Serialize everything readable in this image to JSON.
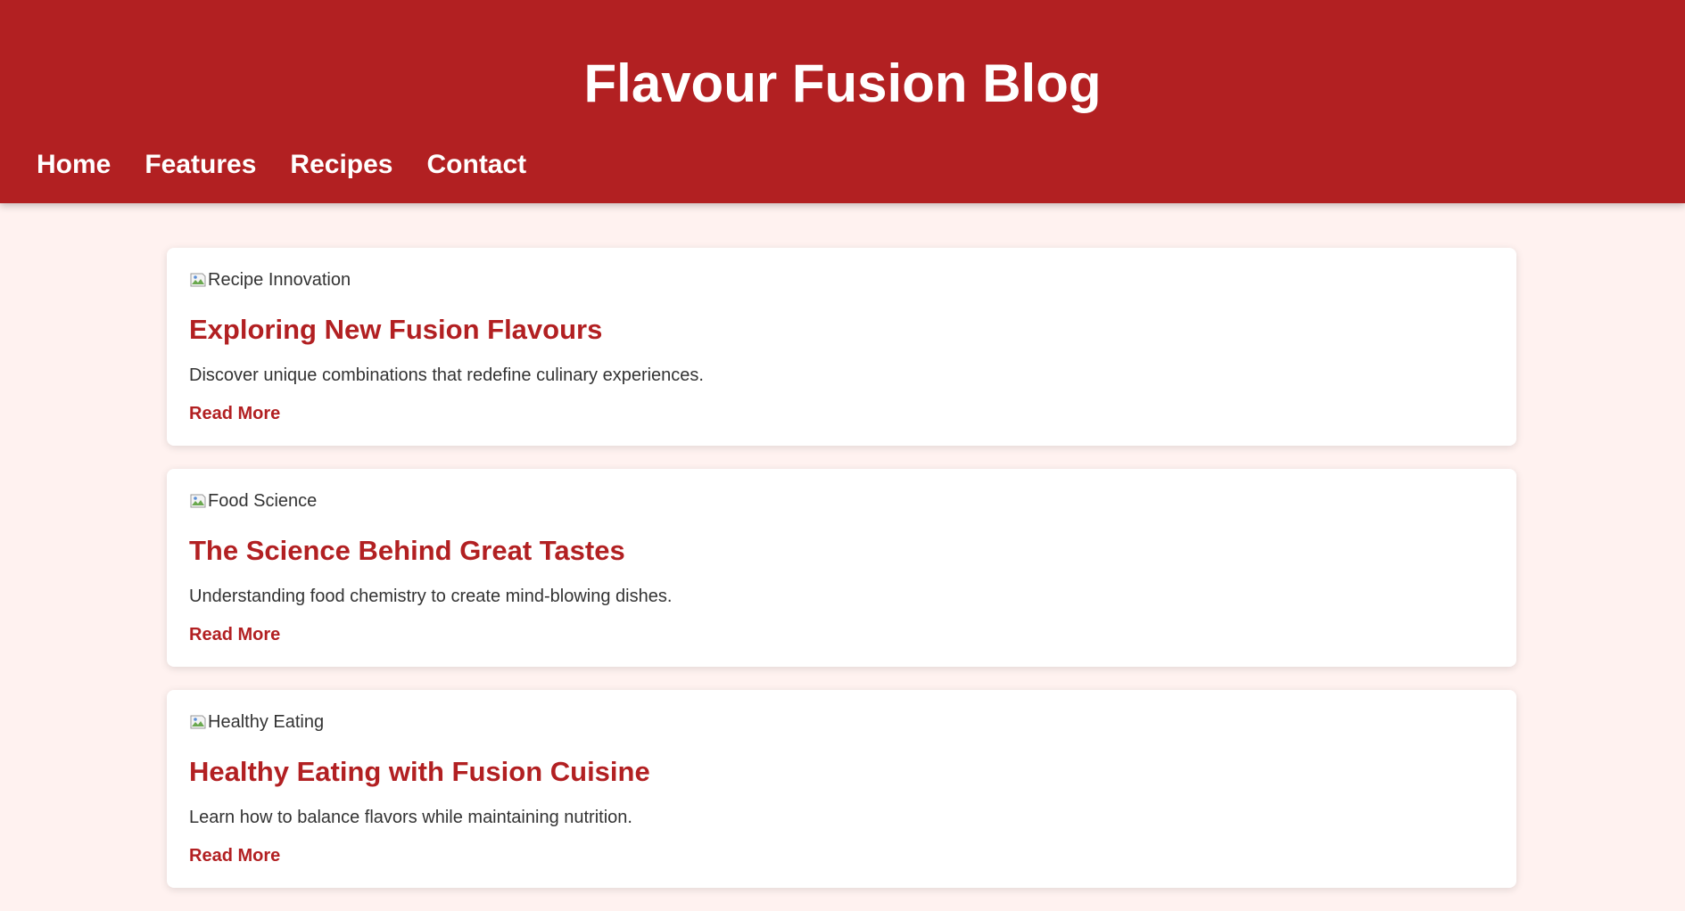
{
  "header": {
    "title": "Flavour Fusion Blog",
    "nav": [
      {
        "label": "Home"
      },
      {
        "label": "Features"
      },
      {
        "label": "Recipes"
      },
      {
        "label": "Contact"
      }
    ]
  },
  "posts": [
    {
      "image_alt": "Recipe Innovation",
      "title": "Exploring New Fusion Flavours",
      "excerpt": "Discover unique combinations that redefine culinary experiences.",
      "link_label": "Read More"
    },
    {
      "image_alt": "Food Science",
      "title": "The Science Behind Great Tastes",
      "excerpt": "Understanding food chemistry to create mind-blowing dishes.",
      "link_label": "Read More"
    },
    {
      "image_alt": "Healthy Eating",
      "title": "Healthy Eating with Fusion Cuisine",
      "excerpt": "Learn how to balance flavors while maintaining nutrition.",
      "link_label": "Read More"
    }
  ],
  "colors": {
    "brand": "#b22022",
    "background": "#fff2f0",
    "card": "#ffffff",
    "text": "#333333"
  },
  "icons": {
    "post_image": "broken-image-icon"
  }
}
